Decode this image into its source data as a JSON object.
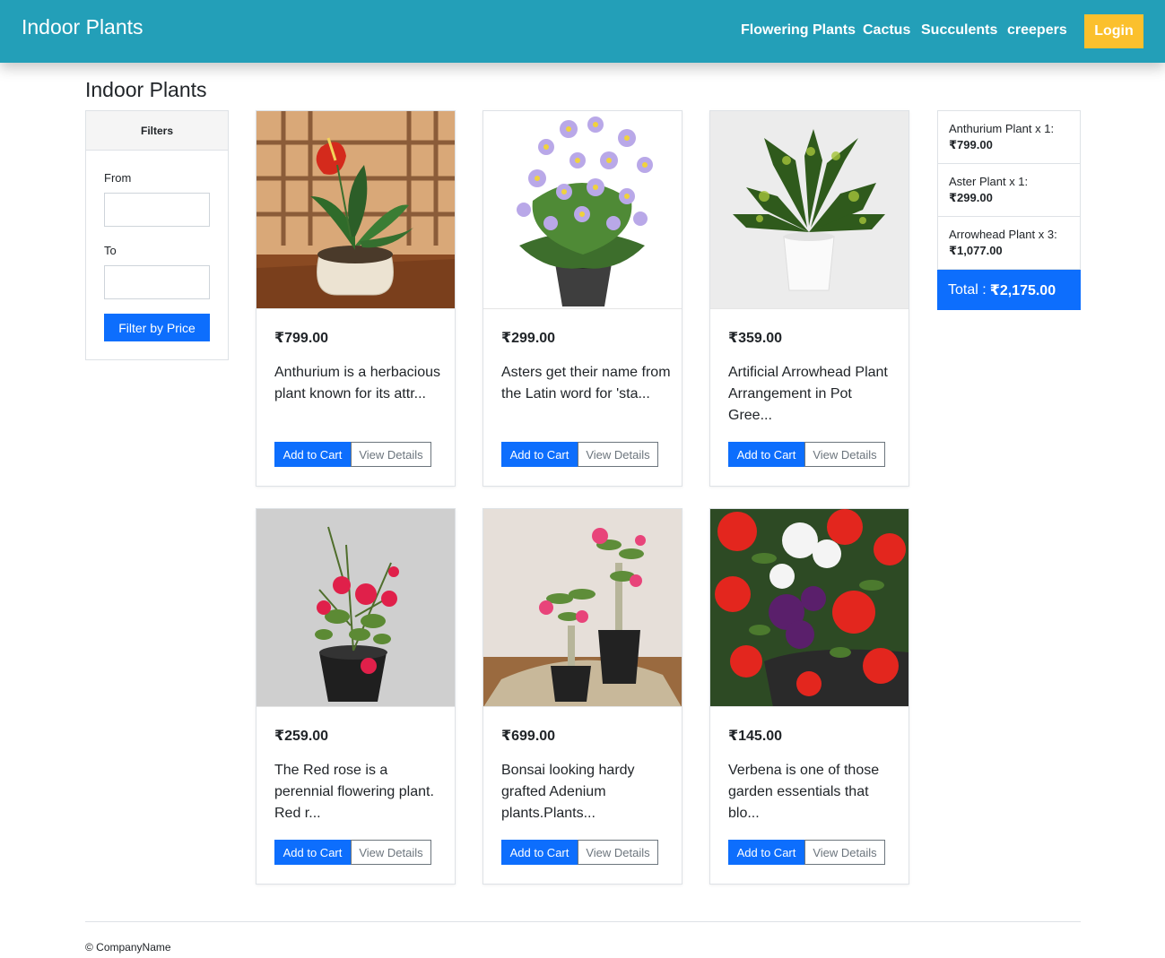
{
  "navbar": {
    "brand": "Indoor Plants",
    "links": [
      "Flowering Plants",
      "Cactus",
      "Succulents",
      "creepers"
    ],
    "login_label": "Login"
  },
  "page": {
    "title": "Indoor Plants"
  },
  "filters": {
    "header": "Filters",
    "from_label": "From",
    "from_value": "",
    "to_label": "To",
    "to_value": "",
    "button_label": "Filter by Price"
  },
  "products": [
    {
      "name": "Anthurium",
      "price": "₹799.00",
      "description": "Anthurium is a herbacious plant known for its attr...",
      "add_label": "Add to Cart",
      "view_label": "View Details"
    },
    {
      "name": "Aster",
      "price": "₹299.00",
      "description": "Asters get their name from the Latin word for 'sta...",
      "add_label": "Add to Cart",
      "view_label": "View Details"
    },
    {
      "name": "Arrowhead",
      "price": "₹359.00",
      "description": "Artificial Arrowhead Plant Arrangement in Pot Gree...",
      "add_label": "Add to Cart",
      "view_label": "View Details"
    },
    {
      "name": "Red rose",
      "price": "₹259.00",
      "description": "The Red rose is a perennial flowering plant. Red r...",
      "add_label": "Add to Cart",
      "view_label": "View Details"
    },
    {
      "name": "Adenium",
      "price": "₹699.00",
      "description": "Bonsai looking hardy grafted Adenium plants.Plants...",
      "add_label": "Add to Cart",
      "view_label": "View Details"
    },
    {
      "name": "Verbena",
      "price": "₹145.00",
      "description": "Verbena is one of those garden essentials that blo...",
      "add_label": "Add to Cart",
      "view_label": "View Details"
    }
  ],
  "cart": {
    "items": [
      {
        "name": "Anthurium Plant x 1:",
        "price": "₹799.00"
      },
      {
        "name": "Aster Plant x 1:",
        "price": "₹299.00"
      },
      {
        "name": "Arrowhead Plant x 3:",
        "price": "₹1,077.00"
      }
    ],
    "total_label": "Total :",
    "total_value": "₹2,175.00"
  },
  "footer": {
    "text": "© CompanyName"
  },
  "colors": {
    "navbar": "#239fb8",
    "primary": "#0d6efd",
    "login": "#fbc02d"
  }
}
